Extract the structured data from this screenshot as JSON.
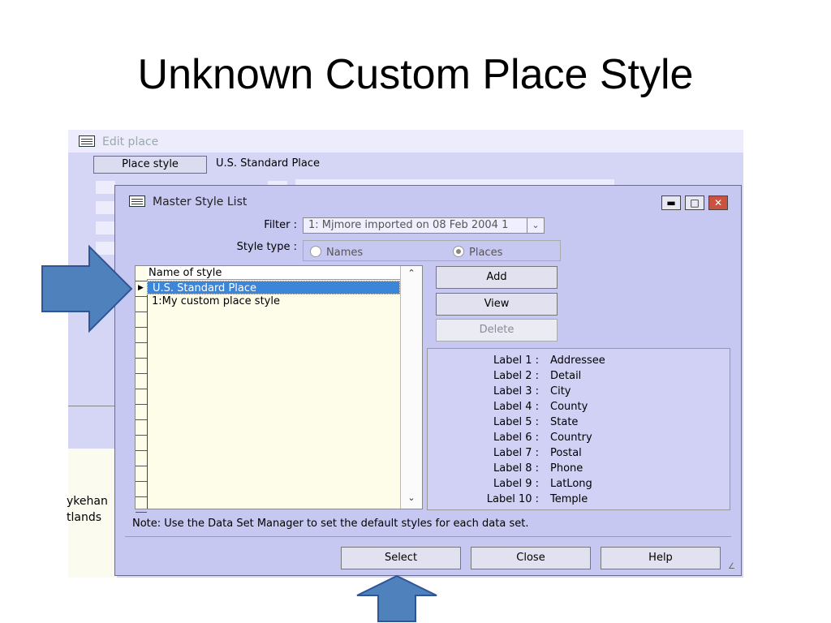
{
  "slide": {
    "title": "Unknown Custom Place Style"
  },
  "edit_place": {
    "title": "Edit place",
    "place_style_button": "Place style",
    "place_style_value": "U.S. Standard Place",
    "partial_text_1": "ykehan",
    "partial_text_2": "tlands"
  },
  "dialog": {
    "title": "Master Style List",
    "filter_label": "Filter :",
    "filter_value": "1:  Mjmore imported on 08 Feb 2004 1",
    "style_type_label": "Style type :",
    "radio_names": "Names",
    "radio_places": "Places",
    "selected_style_type": "Places",
    "list_header": "Name of style",
    "list_items": [
      "U.S. Standard Place",
      "1:My custom place style"
    ],
    "selected_item": "U.S. Standard Place",
    "buttons": {
      "add": "Add",
      "view": "View",
      "delete": "Delete",
      "select": "Select",
      "close": "Close",
      "help": "Help"
    },
    "labels": [
      {
        "key": "Label 1 :",
        "value": "Addressee"
      },
      {
        "key": "Label 2 :",
        "value": "Detail"
      },
      {
        "key": "Label 3 :",
        "value": "City"
      },
      {
        "key": "Label 4 :",
        "value": "County"
      },
      {
        "key": "Label 5 :",
        "value": "State"
      },
      {
        "key": "Label 6 :",
        "value": "Country"
      },
      {
        "key": "Label 7 :",
        "value": "Postal"
      },
      {
        "key": "Label 8 :",
        "value": "Phone"
      },
      {
        "key": "Label 9 :",
        "value": "LatLong"
      },
      {
        "key": "Label 10 :",
        "value": "Temple"
      }
    ],
    "note": "Note: Use the Data Set Manager to set the default styles for each data set."
  },
  "colors": {
    "arrow_fill": "#4f81bd",
    "arrow_stroke": "#2f5597",
    "selection": "#3b86d8",
    "close_button": "#c9533f"
  }
}
